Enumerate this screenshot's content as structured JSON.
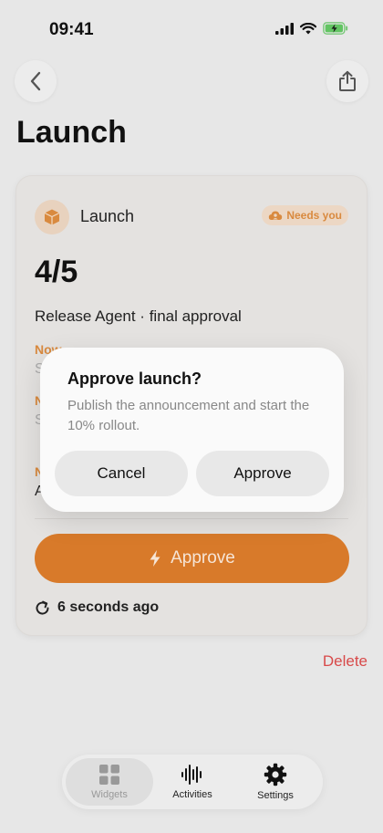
{
  "status_bar": {
    "time": "09:41",
    "icons": [
      "signal-icon",
      "wifi-icon",
      "battery-charging-icon"
    ]
  },
  "nav": {
    "back_icon": "chevron-left-icon",
    "share_icon": "share-icon",
    "title": "Launch"
  },
  "card": {
    "app_icon": "box-icon",
    "app_name": "Launch",
    "badge": {
      "icon": "cloud-person-icon",
      "label": "Needs you"
    },
    "progress": "4/5",
    "agent_line": "Release Agent · final approval",
    "sections": [
      {
        "label": "Now",
        "value": "S"
      },
      {
        "label": "N",
        "value": "S"
      },
      {
        "label": "N",
        "value": "A"
      }
    ],
    "approve_label": "Approve",
    "approve_icon": "bolt-icon",
    "updated": "6 seconds ago",
    "refresh_icon": "refresh-icon"
  },
  "delete_label": "Delete",
  "dialog": {
    "title": "Approve launch?",
    "message": "Publish the announcement and start the 10% rollout.",
    "cancel_label": "Cancel",
    "confirm_label": "Approve"
  },
  "tab_bar": {
    "tabs": [
      {
        "label": "Widgets",
        "icon": "grid-icon",
        "selected": true
      },
      {
        "label": "Activities",
        "icon": "waveform-icon",
        "selected": false
      },
      {
        "label": "Settings",
        "icon": "gear-icon",
        "selected": false
      }
    ]
  },
  "colors": {
    "accent": "#d87a2a",
    "badge_text": "#d98a3f",
    "destructive": "#d84a4a",
    "background": "#e7e7e7"
  }
}
